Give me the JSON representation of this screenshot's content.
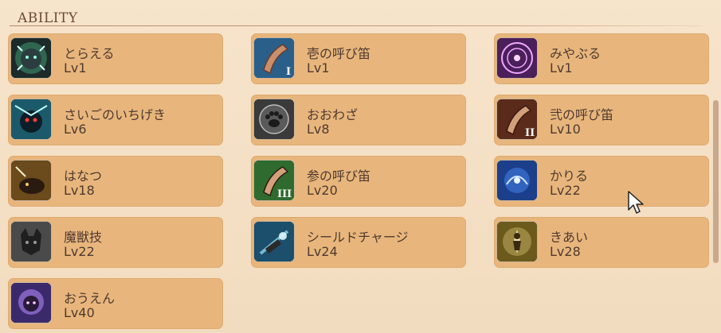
{
  "section": {
    "title": "ABILITY"
  },
  "abilities": [
    {
      "name": "とらえる",
      "level": "Lv1",
      "icon": "capture-icon"
    },
    {
      "name": "壱の呼び笛",
      "level": "Lv1",
      "icon": "horn-1-icon"
    },
    {
      "name": "みやぶる",
      "level": "Lv1",
      "icon": "magic-circle-icon"
    },
    {
      "name": "さいごのいちげき",
      "level": "Lv6",
      "icon": "final-strike-icon"
    },
    {
      "name": "おおわざ",
      "level": "Lv8",
      "icon": "paw-icon"
    },
    {
      "name": "弐の呼び笛",
      "level": "Lv10",
      "icon": "horn-2-icon"
    },
    {
      "name": "はなつ",
      "level": "Lv18",
      "icon": "release-icon"
    },
    {
      "name": "参の呼び笛",
      "level": "Lv20",
      "icon": "horn-3-icon"
    },
    {
      "name": "かりる",
      "level": "Lv22",
      "icon": "borrow-icon"
    },
    {
      "name": "魔獣技",
      "level": "Lv22",
      "icon": "beast-mask-icon"
    },
    {
      "name": "シールドチャージ",
      "level": "Lv24",
      "icon": "shield-charge-icon"
    },
    {
      "name": "きあい",
      "level": "Lv28",
      "icon": "focus-icon"
    },
    {
      "name": "おうえん",
      "level": "Lv40",
      "icon": "cheer-icon"
    }
  ],
  "colors": {
    "card": "#e8b67c",
    "text": "#4f3a2f",
    "title": "#6e4a36",
    "background": "#f3dfc3"
  }
}
